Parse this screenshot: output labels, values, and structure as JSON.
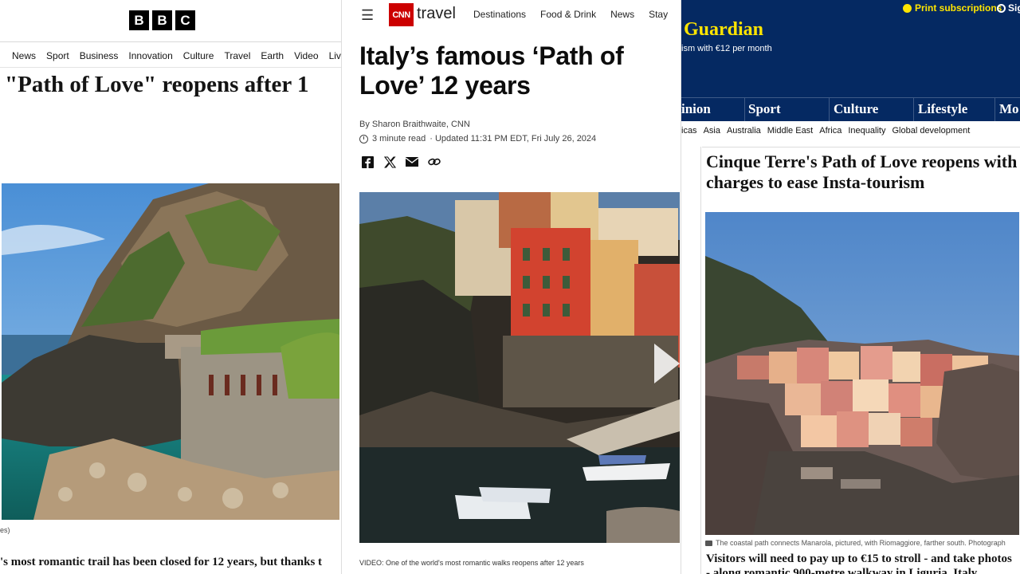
{
  "bbc": {
    "logo_letters": [
      "B",
      "B",
      "C"
    ],
    "nav": [
      "News",
      "Sport",
      "Business",
      "Innovation",
      "Culture",
      "Travel",
      "Earth",
      "Video",
      "Liv"
    ],
    "headline": "\"Path of Love\" reopens after 1",
    "photo_credit": "es)",
    "summary": "'s most romantic trail has been closed for 12 years, but thanks t"
  },
  "cnn": {
    "menu_icon": "hamburger-menu-icon",
    "logo": "CNN",
    "section": "travel",
    "nav": [
      "Destinations",
      "Food & Drink",
      "News",
      "Stay"
    ],
    "headline": "Italy’s famous ‘Path of Love’ 12 years",
    "byline": "By Sharon Braithwaite, CNN",
    "read_time": "3 minute read",
    "updated": "· Updated 11:31 PM EDT, Fri July 26, 2024",
    "share_icons": [
      "facebook-icon",
      "x-icon",
      "email-icon",
      "link-icon"
    ],
    "video_caption": "VIDEO: One of the world's most romantic walks reopens after 12 years"
  },
  "guardian": {
    "print_subscriptions": "Print subscriptions",
    "sign_in": "Sig",
    "logo": "Guardian",
    "promo": "ism with €12 per month",
    "pillars": [
      "inion",
      "Sport",
      "Culture",
      "Lifestyle",
      "Mo"
    ],
    "subnav": [
      "icas",
      "Asia",
      "Australia",
      "Middle East",
      "Africa",
      "Inequality",
      "Global development"
    ],
    "headline": "Cinque Terre's Path of Love reopens with charges to ease Insta-tourism",
    "caption": "The coastal path connects Manarola, pictured, with Riomaggiore, farther south. Photograph",
    "standfirst": "Visitors will need to pay up to €15 to stroll - and take photos - along romantic 900-metre walkway in Liguria, Italy"
  },
  "colors": {
    "bbc_black": "#000000",
    "cnn_red": "#cc0000",
    "guardian_navy": "#052962",
    "guardian_yellow": "#ffe500"
  }
}
